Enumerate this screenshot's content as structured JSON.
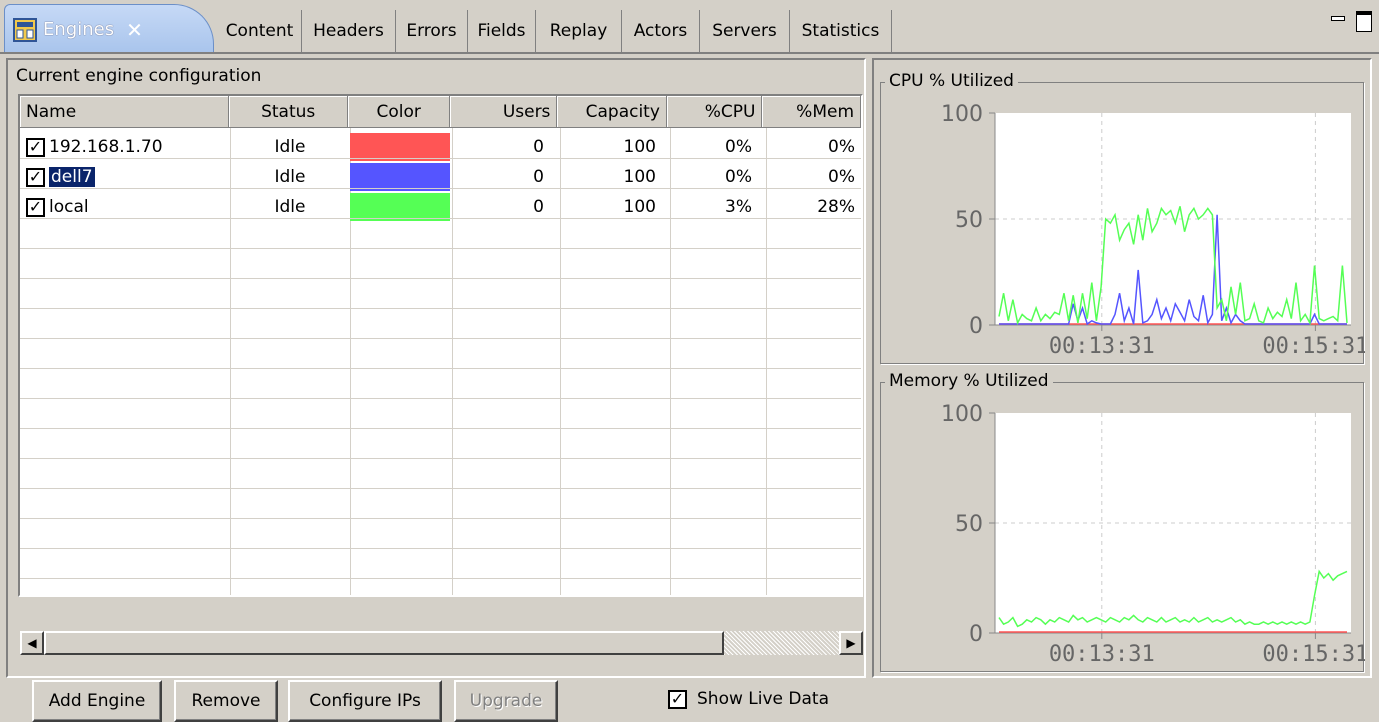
{
  "tabs": {
    "active": {
      "label": "Engines",
      "close": "✕"
    },
    "items": [
      "Content",
      "Headers",
      "Errors",
      "Fields",
      "Replay",
      "Actors",
      "Servers",
      "Statistics"
    ]
  },
  "engines": {
    "title": "Current engine configuration",
    "columns": [
      "Name",
      "Status",
      "Color",
      "Users",
      "Capacity",
      "%CPU",
      "%Mem"
    ],
    "rows": [
      {
        "name": "192.168.1.70",
        "checked": true,
        "selected": false,
        "status": "Idle",
        "color": "#ff5555",
        "users": "0",
        "capacity": "100",
        "cpu": "0%",
        "mem": "0%"
      },
      {
        "name": "dell7",
        "checked": true,
        "selected": true,
        "status": "Idle",
        "color": "#5555ff",
        "users": "0",
        "capacity": "100",
        "cpu": "0%",
        "mem": "0%"
      },
      {
        "name": "local",
        "checked": true,
        "selected": false,
        "status": "Idle",
        "color": "#55ff55",
        "users": "0",
        "capacity": "100",
        "cpu": "3%",
        "mem": "28%"
      }
    ]
  },
  "buttons": {
    "add": "Add Engine",
    "remove": "Remove",
    "configure": "Configure IPs",
    "upgrade": "Upgrade",
    "live_data": "Show Live Data"
  },
  "charts": {
    "cpu": {
      "title": "CPU % Utilized"
    },
    "mem": {
      "title": "Memory % Utilized"
    }
  },
  "chart_data": [
    {
      "type": "line",
      "title": "CPU % Utilized",
      "ylim": [
        0,
        100
      ],
      "yticks": [
        "100",
        "50",
        "0"
      ],
      "xticks": [
        "00:13:31",
        "00:15:31"
      ],
      "grid": true,
      "series": [
        {
          "color": "#55ff55",
          "values": [
            4,
            15,
            2,
            12,
            1,
            5,
            3,
            2,
            8,
            2,
            5,
            3,
            6,
            5,
            15,
            2,
            14,
            1,
            15,
            3,
            20,
            2,
            18,
            50,
            48,
            52,
            40,
            45,
            48,
            38,
            52,
            40,
            55,
            44,
            48,
            55,
            52,
            54,
            48,
            56,
            44,
            52,
            55,
            50,
            52,
            55,
            52,
            8,
            12,
            2,
            18,
            5,
            20,
            2,
            3,
            10,
            2,
            1,
            8,
            3,
            6,
            4,
            12,
            3,
            20,
            2,
            5,
            1,
            28,
            3,
            2,
            3,
            4,
            2,
            28,
            1
          ]
        },
        {
          "color": "#5555ff",
          "values": [
            0,
            0,
            0,
            0,
            0,
            0,
            0,
            0,
            0,
            0,
            0,
            0,
            0,
            0,
            0,
            0,
            10,
            2,
            8,
            0,
            2,
            1,
            0,
            0,
            0,
            5,
            15,
            2,
            8,
            0,
            26,
            1,
            2,
            5,
            12,
            3,
            8,
            2,
            10,
            6,
            2,
            12,
            4,
            2,
            14,
            1,
            5,
            52,
            2,
            8,
            1,
            5,
            2,
            0,
            0,
            0,
            0,
            0,
            0,
            0,
            0,
            0,
            0,
            0,
            0,
            0,
            0,
            0,
            5,
            0,
            0,
            0,
            0,
            0,
            0,
            0
          ]
        },
        {
          "color": "#ff5555",
          "values": [
            0,
            0,
            0,
            0,
            0,
            0,
            0,
            0,
            0,
            0,
            0,
            0,
            0,
            0,
            0,
            0,
            0,
            0,
            0,
            0,
            0,
            0,
            0,
            0,
            0,
            0,
            0,
            0,
            0,
            0,
            0,
            0,
            0,
            0,
            0,
            0,
            0,
            0,
            0,
            0,
            0,
            0,
            0,
            0,
            0,
            0,
            0,
            0,
            0,
            0,
            0,
            0,
            0,
            0,
            0,
            0,
            0,
            0,
            0,
            0,
            0,
            0,
            0,
            0,
            0,
            0,
            0,
            0,
            0,
            0,
            0,
            0,
            0,
            0,
            0,
            0
          ]
        }
      ]
    },
    {
      "type": "line",
      "title": "Memory % Utilized",
      "ylim": [
        0,
        100
      ],
      "yticks": [
        "100",
        "50",
        "0"
      ],
      "xticks": [
        "00:13:31",
        "00:15:31"
      ],
      "grid": true,
      "series": [
        {
          "color": "#55ff55",
          "values": [
            7,
            4,
            5,
            7,
            3,
            4,
            6,
            5,
            7,
            6,
            4,
            6,
            5,
            7,
            6,
            5,
            8,
            6,
            7,
            5,
            6,
            7,
            6,
            5,
            7,
            6,
            5,
            7,
            6,
            8,
            6,
            5,
            7,
            6,
            5,
            7,
            5,
            6,
            7,
            5,
            6,
            5,
            7,
            5,
            6,
            7,
            5,
            6,
            5,
            6,
            7,
            5,
            6,
            4,
            5,
            4,
            4,
            5,
            4,
            5,
            4,
            5,
            4,
            5,
            4,
            5,
            4,
            5,
            17,
            28,
            25,
            27,
            24,
            26,
            27,
            28
          ]
        },
        {
          "color": "#ff5555",
          "values": [
            0,
            0,
            0,
            0,
            0,
            0,
            0,
            0,
            0,
            0,
            0,
            0,
            0,
            0,
            0,
            0,
            0,
            0,
            0,
            0,
            0,
            0,
            0,
            0,
            0,
            0,
            0,
            0,
            0,
            0,
            0,
            0,
            0,
            0,
            0,
            0,
            0,
            0,
            0,
            0,
            0,
            0,
            0,
            0,
            0,
            0,
            0,
            0,
            0,
            0,
            0,
            0,
            0,
            0,
            0,
            0,
            0,
            0,
            0,
            0,
            0,
            0,
            0,
            0,
            0,
            0,
            0,
            0,
            0,
            0,
            0,
            0,
            0,
            0,
            0,
            0
          ]
        }
      ]
    }
  ]
}
